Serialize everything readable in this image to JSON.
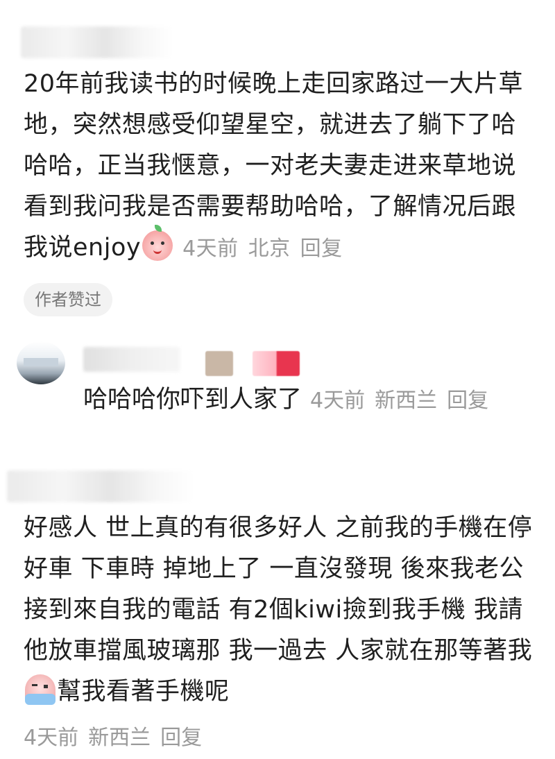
{
  "comments": [
    {
      "text": "20年前我读书的时候晚上走回家路过一大片草地，突然想感受仰望星空，就进去了躺下了哈哈哈，正当我惬意，一对老夫妻走进来草地说看到我问我是否需要帮助哈哈，了解情况后跟我说enjoy",
      "emoji": "smile-face-icon",
      "time": "4天前",
      "location": "北京",
      "reply_label": "回复",
      "author_tag": "作者赞过"
    },
    {
      "text": "哈哈哈你吓到人家了",
      "time": "4天前",
      "location": "新西兰",
      "reply_label": "回复"
    },
    {
      "text_part1": "好感人 世上真的有很多好人 之前我的手機在停好車 下車時 掉地上了 一直沒發現 後來我老公接到來自我的電話 有2個kiwi撿到我手機 我請他放車擋風玻璃那 我一過去 人家就在那等著我",
      "text_part2": "幫我看著手機呢",
      "emoji": "crying-face-icon",
      "time": "4天前",
      "location": "新西兰",
      "reply_label": "回复"
    }
  ],
  "colors": {
    "text": "#1f1f1f",
    "meta": "#9a9a9a",
    "tag_bg": "#f2f2f2"
  }
}
